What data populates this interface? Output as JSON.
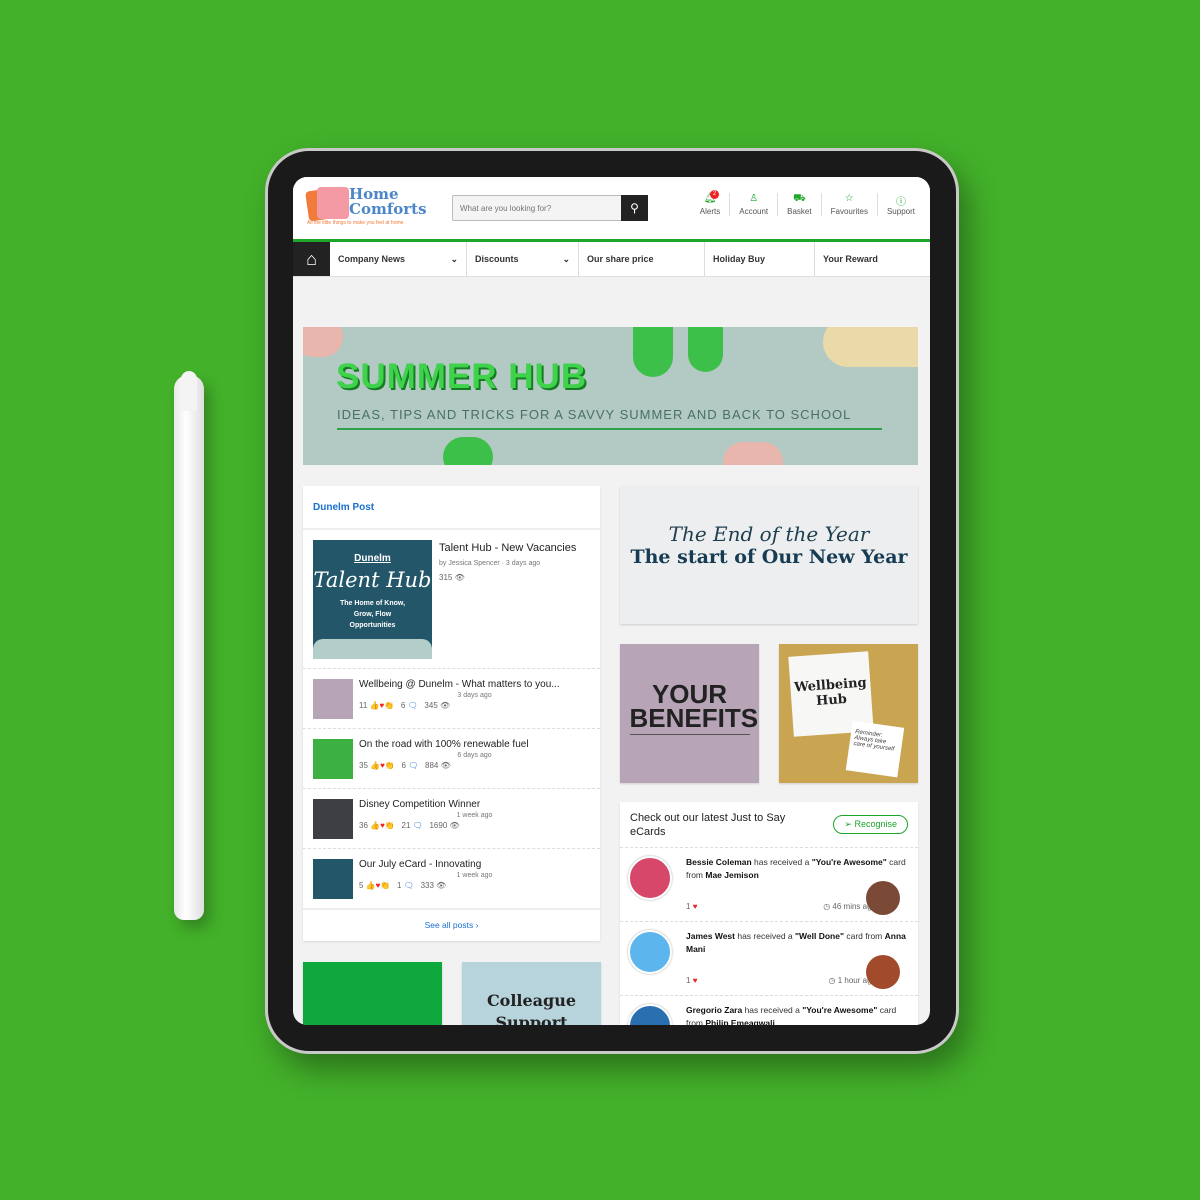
{
  "brand": {
    "name_line1": "Home",
    "name_line2": "Comforts",
    "tagline": "All the little things to make you feel at home"
  },
  "search": {
    "placeholder": "What are you looking for?"
  },
  "header_icons": [
    {
      "label": "Alerts",
      "icon": "bell-icon",
      "badge": "2"
    },
    {
      "label": "Account",
      "icon": "user-icon"
    },
    {
      "label": "Basket",
      "icon": "basket-icon"
    },
    {
      "label": "Favourites",
      "icon": "star-icon"
    },
    {
      "label": "Support",
      "icon": "help-icon"
    }
  ],
  "nav": [
    {
      "label": "Company News",
      "dropdown": true
    },
    {
      "label": "Discounts",
      "dropdown": true
    },
    {
      "label": "Our share price"
    },
    {
      "label": "Holiday Buy"
    },
    {
      "label": "Your Reward"
    }
  ],
  "banner": {
    "title": "SUMMER HUB",
    "subtitle": "IDEAS, TIPS AND TRICKS FOR A SAVVY SUMMER AND BACK TO SCHOOL"
  },
  "post_card": {
    "title": "Dunelm Post",
    "featured": {
      "title": "Talent Hub - New Vacancies",
      "meta": "by Jessica Spencer · 3 days ago",
      "views": "315",
      "image_brand": "Dunelm",
      "image_title": "Talent Hub",
      "image_text": "The Home of Know, Grow, Flow Opportunities"
    },
    "posts": [
      {
        "title": "Wellbeing @ Dunelm - What matters to you...",
        "time": "3 days ago",
        "reactions": "11",
        "comments": "6",
        "views": "345",
        "thumb": "#b7a5b7"
      },
      {
        "title": "On the road with 100% renewable fuel",
        "time": "6 days ago",
        "reactions": "35",
        "comments": "6",
        "views": "884",
        "thumb": "#3cb043"
      },
      {
        "title": "Disney Competition Winner",
        "time": "1 week ago",
        "reactions": "36",
        "comments": "21",
        "views": "1690",
        "thumb": "#3d3f45"
      },
      {
        "title": "Our July eCard - Innovating",
        "time": "1 week ago",
        "reactions": "5",
        "comments": "1",
        "views": "333",
        "thumb": "#24566a"
      }
    ],
    "see_all": "See all posts ›"
  },
  "promo": {
    "script": "The End of the Year",
    "headline": "The start of Our New Year"
  },
  "tiles": {
    "benefits": "YOUR BENEFITS",
    "wellbeing": "Wellbeing Hub",
    "note": "Reminder: Always take care of yourself",
    "colleague": "Colleague Support"
  },
  "ecards": {
    "title": "Check out our latest Just to Say eCards",
    "button": "Recognise",
    "items": [
      {
        "recipient": "Bessie Coleman",
        "text": " has received a ",
        "card": "\"You're Awesome\"",
        "from_text": " card from ",
        "sender": "Mae Jemison",
        "likes": "1",
        "time": "46 mins ago"
      },
      {
        "recipient": "James West",
        "text": " has received a ",
        "card": "\"Well Done\"",
        "from_text": " card from ",
        "sender": "Anna Mani",
        "likes": "1",
        "time": "1 hour ago"
      },
      {
        "recipient": "Gregorio Zara",
        "text": " has received a ",
        "card": "\"You're Awesome\"",
        "from_text": " card from ",
        "sender": "Philip Emeagwali",
        "likes": "",
        "time": ""
      }
    ]
  },
  "colors": {
    "background": "#43b12a",
    "accent": "#1ea52a",
    "link": "#1a6fd1"
  }
}
